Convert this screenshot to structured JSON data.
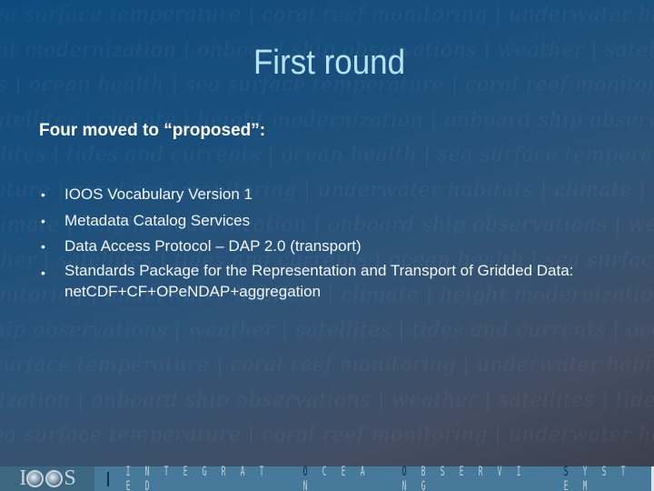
{
  "slide": {
    "title": "First round",
    "subtitle": "Four moved to “proposed”:",
    "bullet_glyph": "•",
    "bullets": [
      "IOOS Vocabulary Version 1",
      "Metadata Catalog Services",
      "Data Access Protocol – DAP 2.0 (transport)",
      "Standards Package for the Representation and Transport of Gridded Data: netCDF+CF+OPeNDAP+aggregation"
    ]
  },
  "background": {
    "watermark_lines": [
      "sea surface temperature | coral reef monitoring | underwater habitats | climate | height",
      "height modernization | onboard ship observations | weather | satellites | tides and currents",
      "currents | ocean health | sea surface temperature | coral reef monitoring | underwater habitats",
      "satellites | climate | height modernization | onboard ship observations | weather | satellites",
      "satellites | tides and currents | ocean health | sea surface temperature | coral reef monitoring",
      "temperature | coral reef monitoring | underwater habitats | climate | height modernization",
      "climate | height modernization | onboard ship observations | weather | satellites | tides and",
      "weather | satellites | tides and currents | ocean health | sea surface temperature | coral reef",
      "reef monitoring | underwater habitats | climate | height modernization | onboard ship",
      "ship observations | weather | satellites | tides and currents | ocean health | sea surface",
      "sea surface temperature | coral reef monitoring | underwater habitats | climate | height",
      "modernization | onboard ship observations | weather | satellites | tides and currents",
      "sea surface temperature | coral reef monitoring | underwater habitats | climate | height"
    ]
  },
  "footer": {
    "logo_text_left": "I",
    "logo_text_right": "S",
    "logo_globes": 2,
    "tagline_words": [
      "INTEGRATED",
      "OCEAN",
      "OBSERVING",
      "SYSTEM"
    ]
  },
  "colors": {
    "title": "#b6e2f3",
    "body_text": "#f2f6fa",
    "footer_bar": "#46799a",
    "footer_logo_bg": "#3d6781"
  }
}
